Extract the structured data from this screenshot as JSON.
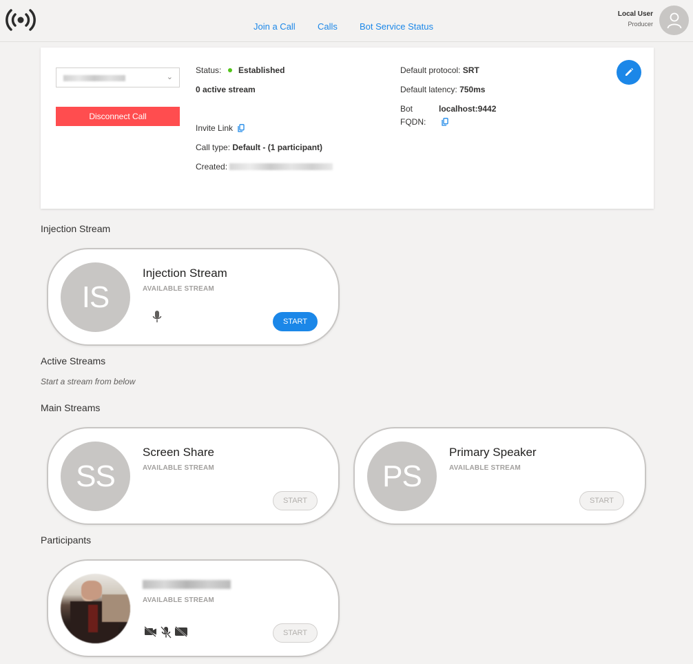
{
  "header": {
    "nav": [
      {
        "label": "Join a Call"
      },
      {
        "label": "Calls"
      },
      {
        "label": "Bot Service Status"
      }
    ],
    "user": {
      "name": "Local User",
      "role": "Producer"
    }
  },
  "call": {
    "disconnect_label": "Disconnect Call",
    "status_label": "Status:",
    "status_value": "Established",
    "status_color": "#52c41a",
    "active_streams": "0 active stream",
    "invite_label": "Invite Link",
    "call_type_label": "Call type:",
    "call_type_value": "Default - (1 participant)",
    "created_label": "Created:",
    "protocol_label": "Default protocol:",
    "protocol_value": "SRT",
    "latency_label": "Default latency:",
    "latency_value": "750ms",
    "bot_label": "Bot",
    "fqdn_label": "FQDN:",
    "bot_value": "localhost:9442"
  },
  "sections": {
    "injection": "Injection Stream",
    "active": "Active Streams",
    "active_hint": "Start a stream from below",
    "main": "Main Streams",
    "participants": "Participants"
  },
  "streams": {
    "injection": {
      "initials": "IS",
      "name": "Injection Stream",
      "sub": "AVAILABLE STREAM",
      "start": "START"
    },
    "screen": {
      "initials": "SS",
      "name": "Screen Share",
      "sub": "AVAILABLE STREAM",
      "start": "START"
    },
    "speaker": {
      "initials": "PS",
      "name": "Primary Speaker",
      "sub": "AVAILABLE STREAM",
      "start": "START"
    },
    "participant": {
      "sub": "AVAILABLE STREAM",
      "start": "START"
    }
  },
  "colors": {
    "accent": "#1b87e8",
    "danger": "#ff4d4f",
    "avatar": "#c8c6c4"
  }
}
